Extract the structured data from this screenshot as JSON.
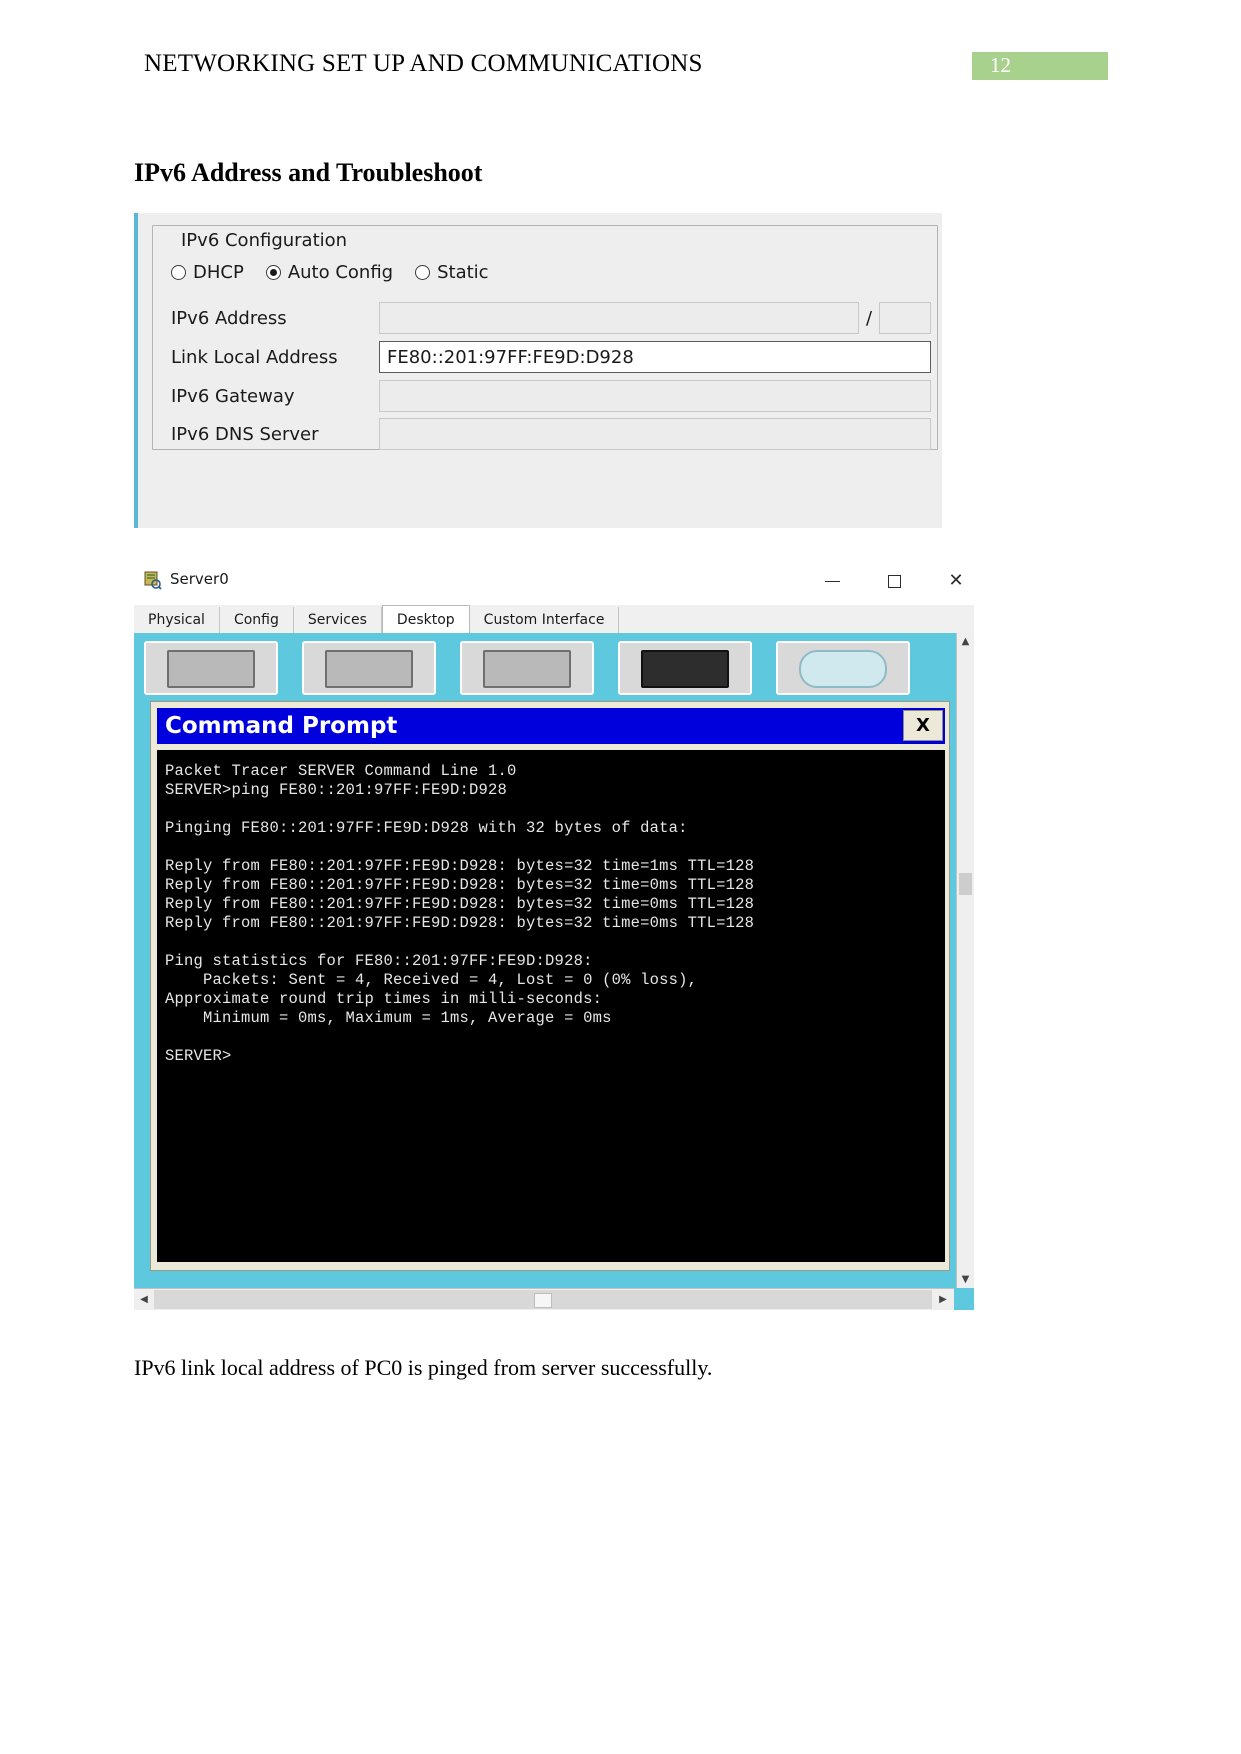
{
  "header": {
    "title": "NETWORKING SET UP AND COMMUNICATIONS",
    "page_number": "12",
    "badge_color": "#a9d18e"
  },
  "section": {
    "heading": "IPv6 Address and Troubleshoot"
  },
  "ipv6_config": {
    "group_title": "IPv6 Configuration",
    "modes": [
      {
        "label": "DHCP",
        "selected": false
      },
      {
        "label": "Auto Config",
        "selected": true
      },
      {
        "label": "Static",
        "selected": false
      }
    ],
    "fields": [
      {
        "label": "IPv6 Address",
        "value": "",
        "has_prefix": true,
        "prefix_separator": "/",
        "prefix_value": "",
        "focused": false
      },
      {
        "label": "Link Local Address",
        "value": "FE80::201:97FF:FE9D:D928",
        "has_prefix": false,
        "focused": true
      },
      {
        "label": "IPv6 Gateway",
        "value": "",
        "has_prefix": false,
        "focused": false
      },
      {
        "label": "IPv6 DNS Server",
        "value": "",
        "has_prefix": false,
        "focused": false
      }
    ]
  },
  "server_window": {
    "title": "Server0",
    "app_icon": "packet-tracer-server-icon",
    "controls": {
      "minimize": "minimize-icon",
      "maximize": "maximize-icon",
      "close": "✕"
    },
    "tabs": [
      {
        "label": "Physical",
        "active": false
      },
      {
        "label": "Config",
        "active": false
      },
      {
        "label": "Services",
        "active": false
      },
      {
        "label": "Desktop",
        "active": true
      },
      {
        "label": "Custom Interface",
        "active": false
      }
    ],
    "desktop_icons": [
      "ip-configuration-icon",
      "dial-up-icon",
      "terminal-icon",
      "command-prompt-icon",
      "web-browser-icon"
    ],
    "scrollbars": {
      "vertical_up": "▲",
      "vertical_down": "▼",
      "horizontal_left": "◀",
      "horizontal_right": "▶"
    }
  },
  "command_prompt": {
    "title": "Command Prompt",
    "close_label": "X",
    "lines": [
      "Packet Tracer SERVER Command Line 1.0",
      "SERVER>ping FE80::201:97FF:FE9D:D928",
      "",
      "Pinging FE80::201:97FF:FE9D:D928 with 32 bytes of data:",
      "",
      "Reply from FE80::201:97FF:FE9D:D928: bytes=32 time=1ms TTL=128",
      "Reply from FE80::201:97FF:FE9D:D928: bytes=32 time=0ms TTL=128",
      "Reply from FE80::201:97FF:FE9D:D928: bytes=32 time=0ms TTL=128",
      "Reply from FE80::201:97FF:FE9D:D928: bytes=32 time=0ms TTL=128",
      "",
      "Ping statistics for FE80::201:97FF:FE9D:D928:",
      "    Packets: Sent = 4, Received = 4, Lost = 0 (0% loss),",
      "Approximate round trip times in milli-seconds:",
      "    Minimum = 0ms, Maximum = 1ms, Average = 0ms",
      "",
      "SERVER>"
    ]
  },
  "caption": {
    "text": "IPv6 link local address of PC0 is pinged from server successfully."
  }
}
